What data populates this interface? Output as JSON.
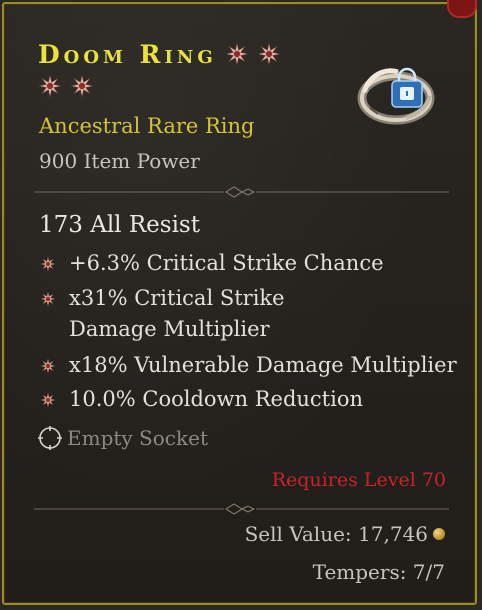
{
  "item": {
    "name": "Doom Ring",
    "type": "Ancestral Rare Ring",
    "item_power": "900 Item Power",
    "implicit": "173 All Resist",
    "affixes": [
      "+6.3% Critical Strike Chance",
      "x31% Critical Strike Damage Multiplier",
      "x18% Vulnerable Damage Multiplier",
      "10.0% Cooldown Reduction"
    ],
    "socket": "Empty Socket",
    "requires": "Requires Level 70",
    "sell_value": "Sell Value: 17,746",
    "tempers": "Tempers: 7/7"
  },
  "icons": {
    "greater_affix": "greater-affix-star-icon",
    "affix_bullet": "affix-star-bullet-icon",
    "socket": "empty-socket-icon",
    "lock": "lock-icon",
    "coin": "gold-coin-icon"
  },
  "colors": {
    "title": "#e8e23a",
    "rarity": "#d2c438",
    "requirement": "#c8222a",
    "border": "#9c8a23"
  }
}
